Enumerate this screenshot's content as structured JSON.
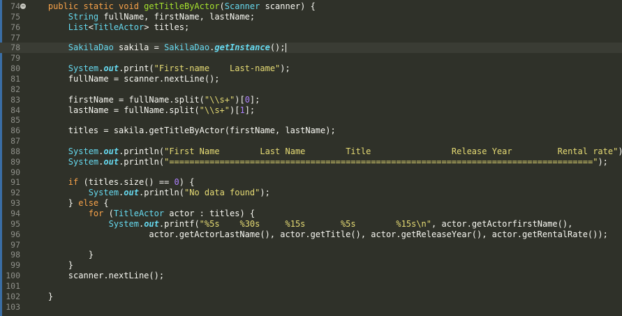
{
  "editor": {
    "lines": [
      {
        "n": "74",
        "fold": true,
        "tokens": [
          [
            "kw",
            "    public static void "
          ],
          [
            "fn",
            "getTitleByActor"
          ],
          [
            "pl",
            "("
          ],
          [
            "ty",
            "Scanner"
          ],
          [
            "pl",
            " scanner) {"
          ]
        ]
      },
      {
        "n": "75",
        "tokens": [
          [
            "ty",
            "        String"
          ],
          [
            "pl",
            " fullName, firstName, lastName;"
          ]
        ]
      },
      {
        "n": "76",
        "tokens": [
          [
            "ty",
            "        List"
          ],
          [
            "pl",
            "<"
          ],
          [
            "ty",
            "TitleActor"
          ],
          [
            "pl",
            "> titles;"
          ]
        ]
      },
      {
        "n": "77",
        "tokens": []
      },
      {
        "n": "78",
        "current": true,
        "cursor": true,
        "tokens": [
          [
            "ty",
            "        SakilaDao"
          ],
          [
            "pl",
            " sakila = "
          ],
          [
            "ty",
            "SakilaDao"
          ],
          [
            "pl",
            "."
          ],
          [
            "it",
            "getInstance"
          ],
          [
            "pl",
            "();"
          ]
        ]
      },
      {
        "n": "79",
        "tokens": []
      },
      {
        "n": "80",
        "tokens": [
          [
            "ty",
            "        System"
          ],
          [
            "pl",
            "."
          ],
          [
            "it",
            "out"
          ],
          [
            "pl",
            ".print("
          ],
          [
            "st",
            "\"First-name    Last-name\""
          ],
          [
            "pl",
            ");"
          ]
        ]
      },
      {
        "n": "81",
        "tokens": [
          [
            "pl",
            "        fullName = scanner.nextLine();"
          ]
        ]
      },
      {
        "n": "82",
        "tokens": []
      },
      {
        "n": "83",
        "tokens": [
          [
            "pl",
            "        firstName = fullName.split("
          ],
          [
            "st",
            "\"\\\\s+\""
          ],
          [
            "pl",
            ")["
          ],
          [
            "nm",
            "0"
          ],
          [
            "pl",
            "];"
          ]
        ]
      },
      {
        "n": "84",
        "tokens": [
          [
            "pl",
            "        lastName = fullName.split("
          ],
          [
            "st",
            "\"\\\\s+\""
          ],
          [
            "pl",
            ")["
          ],
          [
            "nm",
            "1"
          ],
          [
            "pl",
            "];"
          ]
        ]
      },
      {
        "n": "85",
        "tokens": []
      },
      {
        "n": "86",
        "tokens": [
          [
            "pl",
            "        titles = sakila.getTitleByActor(firstName, lastName);"
          ]
        ]
      },
      {
        "n": "87",
        "tokens": []
      },
      {
        "n": "88",
        "tokens": [
          [
            "ty",
            "        System"
          ],
          [
            "pl",
            "."
          ],
          [
            "it",
            "out"
          ],
          [
            "pl",
            ".println("
          ],
          [
            "st",
            "\"First Name        Last Name        Title                Release Year         Rental rate\""
          ],
          [
            "pl",
            ");"
          ]
        ]
      },
      {
        "n": "89",
        "tokens": [
          [
            "ty",
            "        System"
          ],
          [
            "pl",
            "."
          ],
          [
            "it",
            "out"
          ],
          [
            "pl",
            ".println("
          ],
          [
            "st",
            "\"====================================================================================\""
          ],
          [
            "pl",
            ");"
          ]
        ]
      },
      {
        "n": "90",
        "tokens": []
      },
      {
        "n": "91",
        "tokens": [
          [
            "kw",
            "        if"
          ],
          [
            "pl",
            " (titles.size() == "
          ],
          [
            "nm",
            "0"
          ],
          [
            "pl",
            ") {"
          ]
        ]
      },
      {
        "n": "92",
        "tokens": [
          [
            "ty",
            "            System"
          ],
          [
            "pl",
            "."
          ],
          [
            "it",
            "out"
          ],
          [
            "pl",
            ".println("
          ],
          [
            "st",
            "\"No data found\""
          ],
          [
            "pl",
            ");"
          ]
        ]
      },
      {
        "n": "93",
        "tokens": [
          [
            "pl",
            "        } "
          ],
          [
            "kw",
            "else"
          ],
          [
            "pl",
            " {"
          ]
        ]
      },
      {
        "n": "94",
        "tokens": [
          [
            "kw",
            "            for"
          ],
          [
            "pl",
            " ("
          ],
          [
            "ty",
            "TitleActor"
          ],
          [
            "pl",
            " actor : titles) {"
          ]
        ]
      },
      {
        "n": "95",
        "tokens": [
          [
            "ty",
            "                System"
          ],
          [
            "pl",
            "."
          ],
          [
            "it",
            "out"
          ],
          [
            "pl",
            ".printf("
          ],
          [
            "st",
            "\"%5s    %30s     %15s       %5s        %15s\\n\""
          ],
          [
            "pl",
            ", actor.getActorfirstName(),"
          ]
        ]
      },
      {
        "n": "96",
        "tokens": [
          [
            "pl",
            "                        actor.getActorLastName(), actor.getTitle(), actor.getReleaseYear(), actor.getRentalRate());"
          ]
        ]
      },
      {
        "n": "97",
        "tokens": []
      },
      {
        "n": "98",
        "tokens": [
          [
            "pl",
            "            }"
          ]
        ]
      },
      {
        "n": "99",
        "tokens": [
          [
            "pl",
            "        }"
          ]
        ]
      },
      {
        "n": "100",
        "tokens": [
          [
            "pl",
            "        scanner.nextLine();"
          ]
        ]
      },
      {
        "n": "101",
        "tokens": []
      },
      {
        "n": "102",
        "tokens": [
          [
            "pl",
            "    }"
          ]
        ]
      },
      {
        "n": "103",
        "tokens": []
      }
    ]
  }
}
